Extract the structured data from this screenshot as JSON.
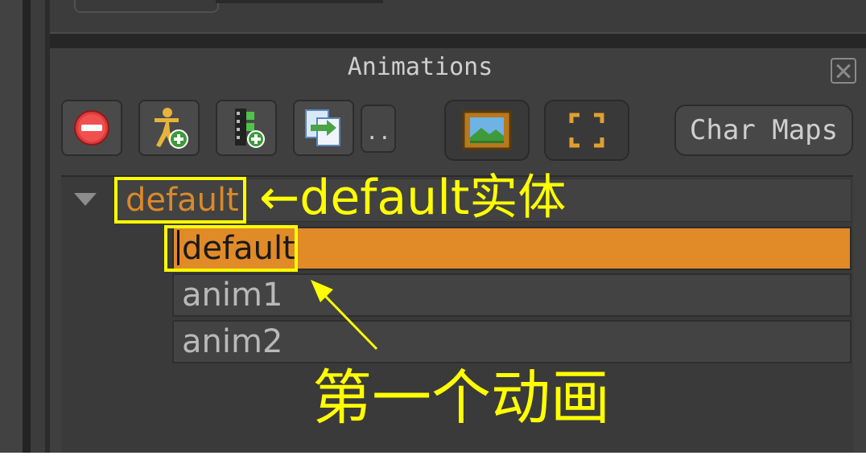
{
  "panel": {
    "title": "Animations",
    "toolbar": {
      "more_label": "..",
      "char_maps_label": "Char Maps"
    }
  },
  "tree": {
    "entity": "default",
    "animations": [
      "default",
      "anim1",
      "anim2"
    ],
    "selected_index": 0
  },
  "annotations": {
    "entity_note": "←default实体",
    "first_anim_note": "第一个动画"
  },
  "icons": {
    "remove": "remove-icon",
    "add_entity": "add-entity-icon",
    "add_animation": "add-animation-icon",
    "duplicate": "duplicate-icon",
    "image": "image-icon",
    "fullscreen": "fullscreen-icon",
    "close": "close-icon",
    "expand": "expand-arrow-icon"
  },
  "colors": {
    "accent_orange": "#e08a28",
    "entity_text": "#d98a2a",
    "annotation": "#ffff00"
  }
}
